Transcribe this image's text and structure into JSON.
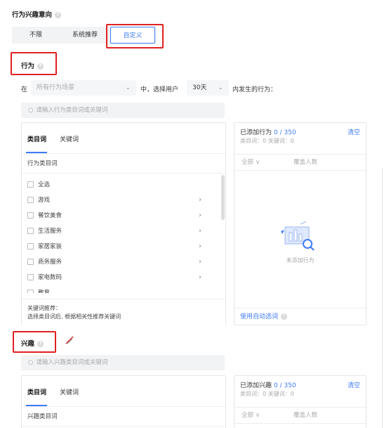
{
  "section_title": "行为兴趣意向",
  "segment": {
    "options": [
      "不限",
      "系统推荐",
      "自定义"
    ]
  },
  "behavior": {
    "title": "行为",
    "prefix": "在",
    "scene_placeholder": "所有行为场景",
    "middle_text": "中，选择用户",
    "days": "30天",
    "suffix": "内发生的行为：",
    "search_placeholder": "请输入行为类目词或关键词",
    "tabs": [
      "类目词",
      "关键词"
    ],
    "category_header": "行为类目词",
    "categories": [
      "全选",
      "游戏",
      "餐饮美食",
      "生活服务",
      "家居家装",
      "商务服务",
      "家电数码",
      "教育"
    ],
    "keyword_recommend_title": "关键词推荐：",
    "keyword_recommend_desc": "选择类目词后, 根据相关性推荐关键词",
    "added_label": "已添加行为",
    "added_count": "0 / 350",
    "clear": "清空",
    "added_detail": "类目词：0   关键词：0",
    "all_label": "全部",
    "coverage_label": "覆盖人数",
    "empty_text": "未添加行为",
    "auto_select": "使用自动选词"
  },
  "interest": {
    "title": "兴趣",
    "search_placeholder": "请输入兴趣类目词或关键词",
    "tabs": [
      "类目词",
      "关键词"
    ],
    "category_header": "兴趣类目词",
    "added_label": "已添加兴趣",
    "added_count": "0 / 350",
    "clear": "清空",
    "added_detail": "类目词：0   关键词：0",
    "all_label": "全部",
    "coverage_label": "覆盖人数"
  },
  "colors": {
    "accent": "#3e7bfa",
    "highlight": "#e02020"
  }
}
